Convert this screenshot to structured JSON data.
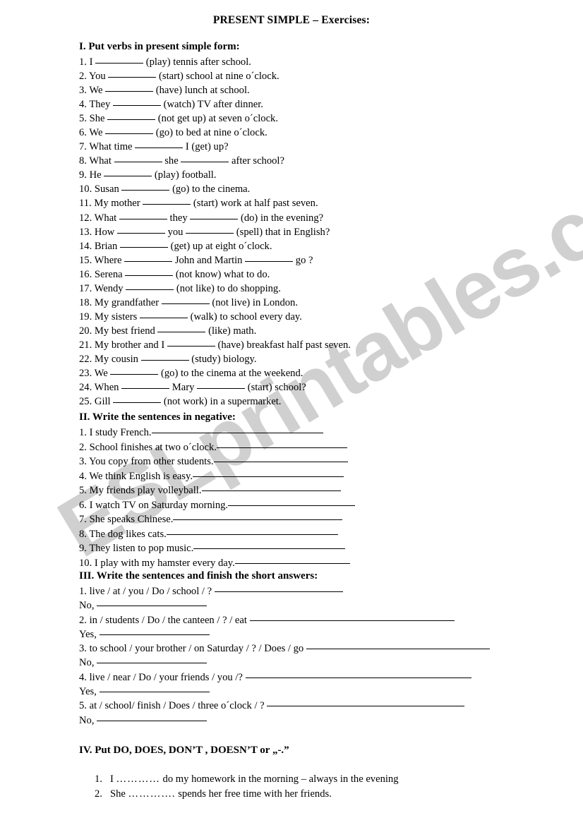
{
  "document": {
    "title": "PRESENT SIMPLE – Exercises:",
    "watermark": "ESLprintables.com",
    "watermark_color": "#d0d0d0"
  },
  "section1": {
    "heading": "I. Put verbs in present simple form:",
    "items": [
      {
        "num": "1.",
        "pre": "I",
        "mid": "",
        "post": "(play) tennis after school.",
        "blanks": 1,
        "w1": 68,
        "w2": 0
      },
      {
        "num": "2.",
        "pre": "You",
        "mid": "",
        "post": "(start) school at nine o´clock.",
        "blanks": 1,
        "w1": 68,
        "w2": 0
      },
      {
        "num": "3.",
        "pre": "We",
        "mid": "",
        "post": "(have) lunch at school.",
        "blanks": 1,
        "w1": 68,
        "w2": 0
      },
      {
        "num": "4.",
        "pre": "They",
        "mid": "",
        "post": "(watch) TV after dinner.",
        "blanks": 1,
        "w1": 68,
        "w2": 0
      },
      {
        "num": "5.",
        "pre": "She",
        "mid": "",
        "post": "(not get up) at seven o´clock.",
        "blanks": 1,
        "w1": 68,
        "w2": 0
      },
      {
        "num": "6.",
        "pre": "We",
        "mid": "",
        "post": "(go) to bed at nine o´clock.",
        "blanks": 1,
        "w1": 68,
        "w2": 0
      },
      {
        "num": "7.",
        "pre": "What time",
        "mid": "",
        "post": "I (get) up?",
        "blanks": 1,
        "w1": 68,
        "w2": 0
      },
      {
        "num": "8.",
        "pre": "What",
        "mid": "she",
        "post": "after school?",
        "blanks": 2,
        "w1": 68,
        "w2": 68
      },
      {
        "num": "9.",
        "pre": "He",
        "mid": "",
        "post": "(play) football.",
        "blanks": 1,
        "w1": 68,
        "w2": 0
      },
      {
        "num": "10.",
        "pre": "Susan",
        "mid": "",
        "post": "(go) to the cinema.",
        "blanks": 1,
        "w1": 68,
        "w2": 0
      },
      {
        "num": "11.",
        "pre": "My mother",
        "mid": "",
        "post": "(start) work at half past seven.",
        "blanks": 1,
        "w1": 68,
        "w2": 0
      },
      {
        "num": "12.",
        "pre": "What",
        "mid": "they",
        "post": "(do) in the evening?",
        "blanks": 2,
        "w1": 68,
        "w2": 68
      },
      {
        "num": "13.",
        "pre": "How",
        "mid": "you",
        "post": "(spell) that in English?",
        "blanks": 2,
        "w1": 68,
        "w2": 68
      },
      {
        "num": "14.",
        "pre": "Brian",
        "mid": "",
        "post": "(get) up at eight o´clock.",
        "blanks": 1,
        "w1": 68,
        "w2": 0
      },
      {
        "num": "15.",
        "pre": "Where",
        "mid": "John and Martin",
        "post": "go ?",
        "blanks": 2,
        "w1": 68,
        "w2": 68
      },
      {
        "num": "16.",
        "pre": "Serena",
        "mid": "",
        "post": "(not know) what to do.",
        "blanks": 1,
        "w1": 68,
        "w2": 0
      },
      {
        "num": "17.",
        "pre": "Wendy",
        "mid": "",
        "post": "(not like) to do shopping.",
        "blanks": 1,
        "w1": 68,
        "w2": 0
      },
      {
        "num": "18.",
        "pre": "My grandfather",
        "mid": "",
        "post": "(not live) in London.",
        "blanks": 1,
        "w1": 68,
        "w2": 0
      },
      {
        "num": "19.",
        "pre": "My sisters",
        "mid": "",
        "post": "(walk) to school every day.",
        "blanks": 1,
        "w1": 68,
        "w2": 0
      },
      {
        "num": "20.",
        "pre": "My best friend",
        "mid": "",
        "post": "(like) math.",
        "blanks": 1,
        "w1": 68,
        "w2": 0
      },
      {
        "num": "21.",
        "pre": "My brother and I",
        "mid": "",
        "post": "(have) breakfast half past seven.",
        "blanks": 1,
        "w1": 68,
        "w2": 0
      },
      {
        "num": "22.",
        "pre": "My cousin",
        "mid": "",
        "post": "(study) biology.",
        "blanks": 1,
        "w1": 68,
        "w2": 0
      },
      {
        "num": "23.",
        "pre": "We",
        "mid": "",
        "post": "(go) to the cinema at the weekend.",
        "blanks": 1,
        "w1": 68,
        "w2": 0
      },
      {
        "num": "24.",
        "pre": "When",
        "mid": "Mary",
        "post": "(start) school?",
        "blanks": 2,
        "w1": 68,
        "w2": 68
      },
      {
        "num": "25.",
        "pre": "Gill",
        "mid": "",
        "post": "(not work) in a supermarket.",
        "blanks": 1,
        "w1": 68,
        "w2": 0
      }
    ]
  },
  "section2": {
    "heading": "II. Write the sentences in negative:",
    "items": [
      {
        "num": "1.",
        "text": "I study French.",
        "rule": 243
      },
      {
        "num": "2.",
        "text": "School finishes at two o´clock.",
        "rule": 185
      },
      {
        "num": "3.",
        "text": "You copy from other students.",
        "rule": 190
      },
      {
        "num": "4.",
        "text": "We think English is easy.",
        "rule": 214
      },
      {
        "num": "5.",
        "text": "My friends play volleyball.",
        "rule": 197
      },
      {
        "num": "6.",
        "text": "I watch TV on Saturday morning.",
        "rule": 180
      },
      {
        "num": "7.",
        "text": "She speaks Chinese.",
        "rule": 240
      },
      {
        "num": "8.",
        "text": "The dog likes cats.",
        "rule": 243
      },
      {
        "num": "9.",
        "text": "They listen to pop music.",
        "rule": 215
      },
      {
        "num": "10.",
        "text": "I play with my hamster every day.",
        "rule": 163
      }
    ]
  },
  "section3": {
    "heading": "III. Write the sentences and finish the short answers:",
    "items": [
      {
        "num": "1.",
        "text": "live / at / you / Do / school / ?",
        "rule": 182,
        "answer": "No,",
        "answer_rule": 156
      },
      {
        "num": "2.",
        "text": "in / students / Do / the canteen / ? / eat",
        "rule": 290,
        "answer": "Yes,",
        "answer_rule": 156
      },
      {
        "num": "3.",
        "text": "to school / your brother / on Saturday / ? / Does / go",
        "rule": 260,
        "answer": "No,",
        "answer_rule": 156
      },
      {
        "num": "4.",
        "text": "live / near / Do / your friends / you /?",
        "rule": 320,
        "answer": "Yes,",
        "answer_rule": 156
      },
      {
        "num": "5.",
        "text": "at / school/ finish / Does / three o´clock / ?",
        "rule": 280,
        "answer": "No,",
        "answer_rule": 156
      }
    ]
  },
  "section4": {
    "heading": "IV. Put DO, DOES, DON’T , DOESN’T or „-.”",
    "items": [
      {
        "num": "1.",
        "pre": "I",
        "dots": "…………",
        "post": "do my homework in the morning – always in the evening"
      },
      {
        "num": "2.",
        "pre": "She",
        "dots": "………….",
        "post": "spends her free time with her friends."
      }
    ]
  }
}
